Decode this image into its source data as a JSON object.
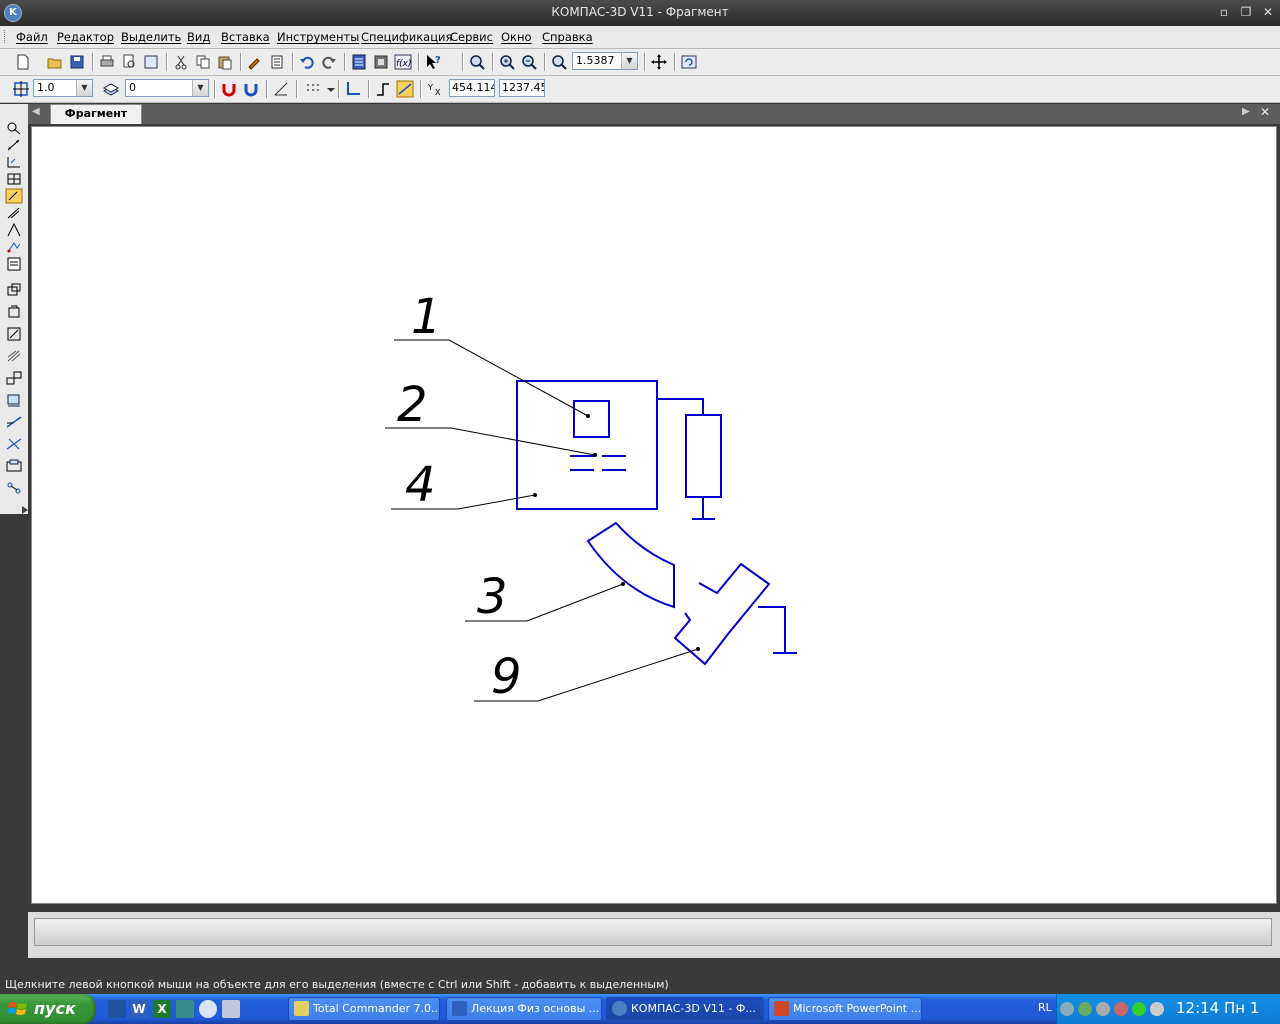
{
  "window": {
    "title": "КОМПАС-3D V11 - Фрагмент",
    "app_icon": "kompas-logo-icon",
    "controls": [
      "minimize-icon",
      "restore-icon",
      "close-icon"
    ]
  },
  "menu": {
    "items": [
      "Файл",
      "Редактор",
      "Выделить",
      "Вид",
      "Вставка",
      "Инструменты",
      "Спецификация",
      "Сервис",
      "Окно",
      "Справка"
    ]
  },
  "toolbar_standard": {
    "zoom_value": "1.5387"
  },
  "toolbar_current_state": {
    "step_value": "1.0",
    "layer_value": "0",
    "coord_x": "454.114",
    "coord_y": "1237.45"
  },
  "document": {
    "tab_label": "Фрагмент"
  },
  "drawing": {
    "line_color": "#0000cc",
    "leader_color": "#000000",
    "callouts": [
      "1",
      "2",
      "4",
      "3",
      "9"
    ]
  },
  "status": {
    "hint": "Щелкните левой кнопкой мыши на объекте для его выделения (вместе с Ctrl или Shift - добавить к выделенным)"
  },
  "taskbar": {
    "start_label": "пуск",
    "tasks": [
      {
        "label": "Total Commander 7.0...",
        "active": false
      },
      {
        "label": "Лекция Физ основы ...",
        "active": false
      },
      {
        "label": "КОМПАС-3D V11 - Ф...",
        "active": true
      },
      {
        "label": "Microsoft PowerPoint ...",
        "active": false
      }
    ],
    "tray_language": "RL",
    "clock": "12:14 Пн 1"
  }
}
